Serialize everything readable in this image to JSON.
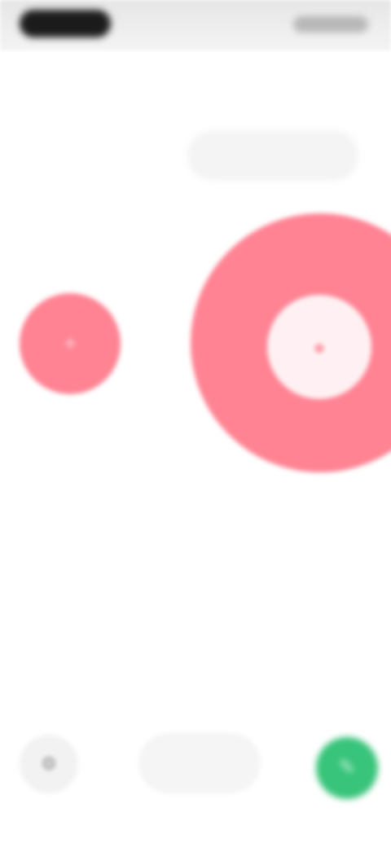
{
  "status_bar": {
    "time": "",
    "icons": [
      "signal-icon",
      "wifi-icon",
      "battery-icon"
    ]
  },
  "header": {
    "title": "",
    "action": ""
  },
  "tabs": [
    {
      "label": ""
    },
    {
      "label": "",
      "selected": true
    }
  ],
  "left_button": {
    "caption": "",
    "label": "",
    "icon": "plus-icon",
    "color": "#ff8393"
  },
  "main_button": {
    "label": "",
    "icon": "record-icon",
    "color": "#ff8393"
  },
  "bottom_bar": {
    "left_icon": "settings-icon",
    "pill_label": "",
    "right_icon": "chat-icon",
    "right_color": "#38c47a"
  },
  "colors": {
    "accent": "#ff8393",
    "action_text": "#ff7a8a",
    "success": "#38c47a"
  }
}
